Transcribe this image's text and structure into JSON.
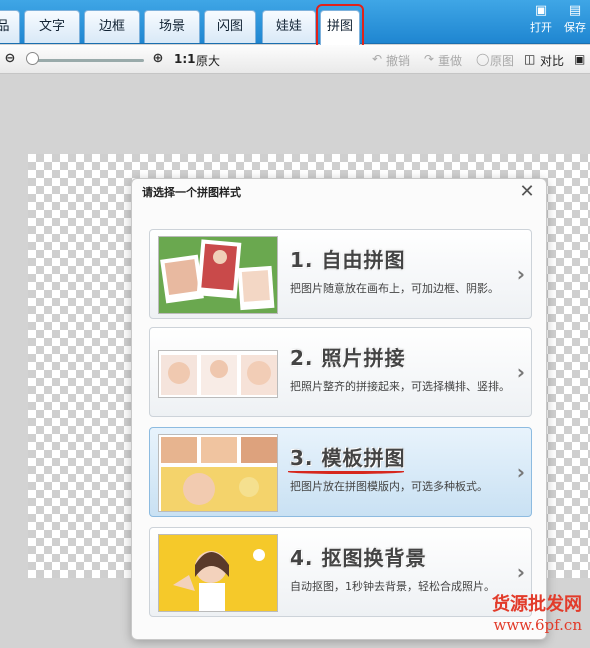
{
  "tabs": [
    {
      "label": "品",
      "active": false
    },
    {
      "label": "文字",
      "active": false
    },
    {
      "label": "边框",
      "active": false
    },
    {
      "label": "场景",
      "active": false
    },
    {
      "label": "闪图",
      "active": false
    },
    {
      "label": "娃娃",
      "active": false
    },
    {
      "label": "拼图",
      "active": true
    }
  ],
  "tools": {
    "open_label": "打开",
    "save_label": "保存"
  },
  "toolbar": {
    "zoom_ratio": "1:1",
    "original_size_label": "原大",
    "undo_label": "撤销",
    "redo_label": "重做",
    "original_image_label": "原图",
    "compare_label": "对比",
    "zoom_level": 0.02
  },
  "dialog": {
    "title": "请选择一个拼图样式",
    "options": [
      {
        "title": "1. 自由拼图",
        "description": "把图片随意放在画布上，可加边框、阴影。",
        "selected": false
      },
      {
        "title": "2. 照片拼接",
        "description": "把照片整齐的拼接起来，可选择横排、竖排。",
        "selected": false
      },
      {
        "title": "3. 模板拼图",
        "description": "把图片放在拼图模版内，可选多种板式。",
        "selected": true
      },
      {
        "title": "4. 抠图换背景",
        "description": "自动抠图，1秒钟去背景，轻松合成照片。",
        "selected": false
      }
    ]
  },
  "watermark": {
    "line1": "货源批发网",
    "line2": "www.6pf.cn"
  },
  "colors": {
    "accent": "#1f86d1",
    "highlight": "#e0221a",
    "selected_bg": "#c9e1f3"
  }
}
